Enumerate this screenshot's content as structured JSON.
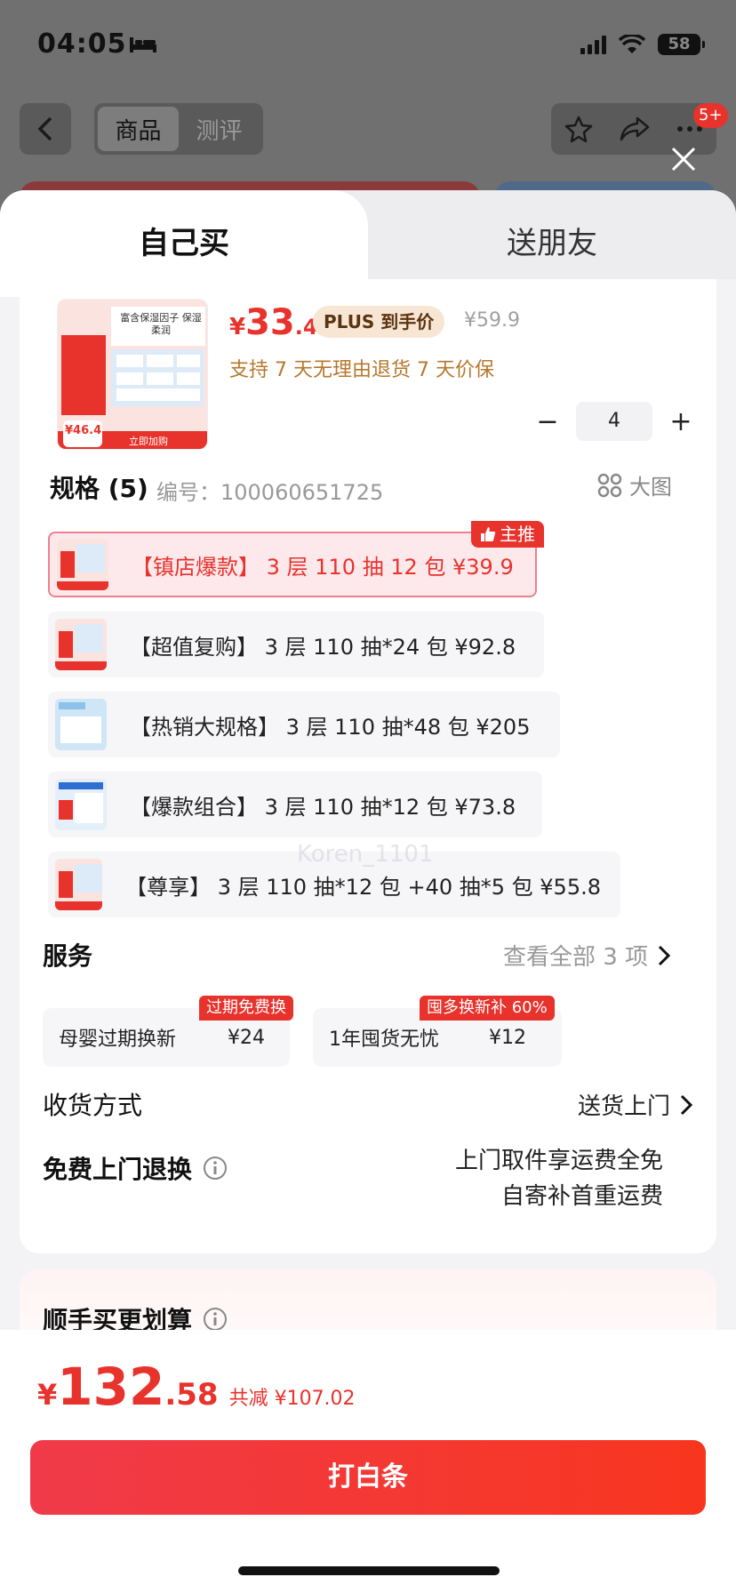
{
  "status_bar": {
    "time": "04:05",
    "battery": "58"
  },
  "header": {
    "tabs": [
      {
        "label": "商品",
        "active": true
      },
      {
        "label": "测评",
        "active": false
      }
    ],
    "notification_badge": "5+"
  },
  "sheet_tabs": {
    "self": "自己买",
    "friend": "送朋友"
  },
  "product": {
    "price_symbol": "¥",
    "price_int": "33",
    "price_dec": ".4",
    "plus_label": "PLUS 到手价",
    "original_price": "¥59.9",
    "services": "支持 7 天无理由退货   7 天价保",
    "image_text": {
      "promo": "富含保湿因子 保湿柔润",
      "price": "¥46.4",
      "cta": "立即加购"
    },
    "quantity": "4"
  },
  "spec": {
    "title": "规格 (5)",
    "code": "编号：100060651725",
    "big_image_label": "大图",
    "main_tag": "主推",
    "options": [
      {
        "label": "【镇店爆款】 3 层 110 抽 12 包  ¥39.9",
        "selected": true
      },
      {
        "label": "【超值复购】 3 层 110 抽*24 包  ¥92.8",
        "selected": false
      },
      {
        "label": "【热销大规格】 3 层 110 抽*48 包  ¥205",
        "selected": false
      },
      {
        "label": "【爆款组合】 3 层 110 抽*12 包  ¥73.8",
        "selected": false
      },
      {
        "label": "【尊享】 3 层 110 抽*12 包 +40 抽*5 包  ¥55.8",
        "selected": false
      }
    ]
  },
  "watermark": "Koren_1101",
  "service": {
    "title": "服务",
    "more": "查看全部 3 项",
    "items": [
      {
        "label": "母婴过期换新",
        "price": "¥24",
        "tag": "过期免费换"
      },
      {
        "label": "1年囤货无忧",
        "price": "¥12",
        "tag": "囤多换新补 60%"
      }
    ]
  },
  "delivery": {
    "label": "收货方式",
    "value": "送货上门"
  },
  "free_return": {
    "label": "免费上门退换",
    "line1": "上门取件享运费全免",
    "line2": "自寄补首重运费"
  },
  "bundle": {
    "title": "顺手买更划算"
  },
  "total": {
    "yen": "¥",
    "int": "132",
    "dec": ".58",
    "saved": "共减 ¥107.02"
  },
  "buy_button": "打白条",
  "colors": {
    "accent": "#e8322c",
    "gold": "#b7772c",
    "plus_bg": "#f8e6d4"
  }
}
